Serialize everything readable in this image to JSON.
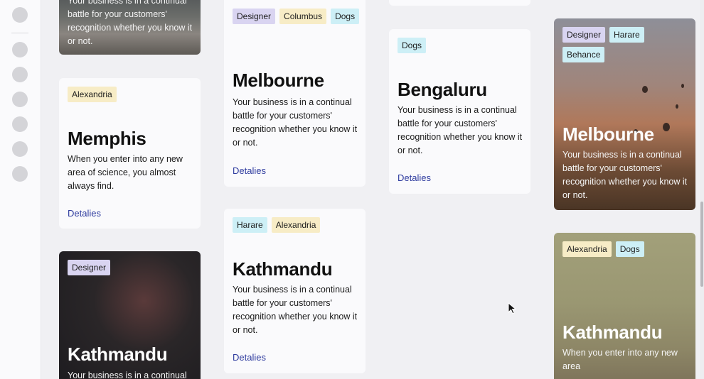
{
  "cards": {
    "c1_desc": "Your business is in a continual battle for your customers' recognition whether you know it or not.",
    "c2": {
      "tag1": "Alexandria",
      "title": "Memphis",
      "desc": "When you enter into any new area of science, you almost always find.",
      "link": "Detalies"
    },
    "c3": {
      "tag1": "Designer",
      "title": "Kathmandu",
      "desc": "Your business is in a continual"
    },
    "c4": {
      "tag1": "Designer",
      "tag2": "Columbus",
      "tag3": "Dogs",
      "title": "Melbourne",
      "desc": "Your business is in a continual battle for your customers' recognition whether you know it or not.",
      "link": "Detalies"
    },
    "c5": {
      "tag1": "Harare",
      "tag2": "Alexandria",
      "title": "Kathmandu",
      "desc": "Your business is in a continual battle for your customers' recognition whether you know it or not.",
      "link": "Detalies"
    },
    "c6": {
      "tag1": "Dogs",
      "title": "Bengaluru",
      "desc": "Your business is in a continual battle for your customers' recognition whether you know it or not.",
      "link": "Detalies"
    },
    "c7": {
      "tag1": "Designer",
      "tag2": "Harare",
      "tag3": "Behance",
      "title": "Melbourne",
      "desc": "Your business is in a continual battle for your customers' recognition whether you know it or not."
    },
    "c8": {
      "tag1": "Alexandria",
      "tag2": "Dogs",
      "title": "Kathmandu",
      "desc": "When you enter into any new area"
    }
  },
  "colors": {
    "tag_designer": "#d9d4f1",
    "tag_city": "#f7ecc6",
    "tag_dogs": "#cdeff6",
    "link": "#2d3a9e"
  }
}
